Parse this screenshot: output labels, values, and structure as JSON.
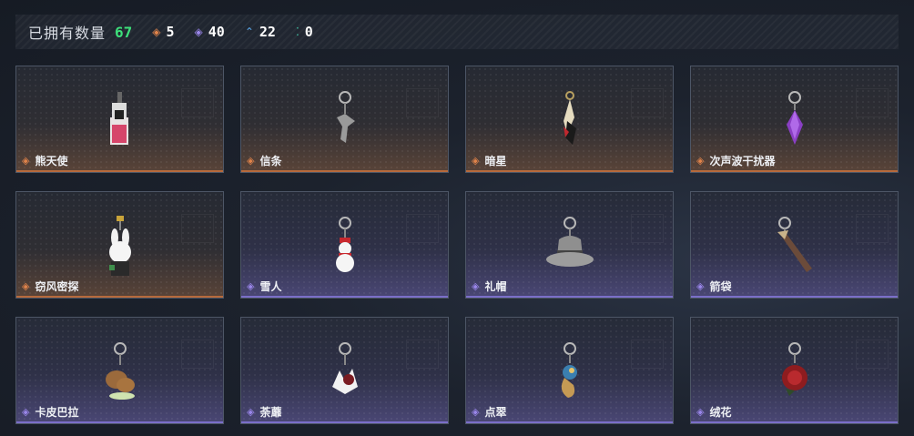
{
  "summary": {
    "owned_label": "已拥有数量",
    "owned_count": "67",
    "rarities": [
      {
        "icon": "legendary-diamond-icon",
        "color": "#e0834a",
        "count": "5"
      },
      {
        "icon": "epic-diamond-icon",
        "color": "#9a86ea",
        "count": "40"
      },
      {
        "icon": "rare-chevron-icon",
        "color": "#5aa6e8",
        "count": "22"
      },
      {
        "icon": "common-dots-icon",
        "color": "#3ec7a8",
        "count": "0"
      }
    ]
  },
  "items": [
    {
      "name": "熊天使",
      "rarity": "legendary"
    },
    {
      "name": "信条",
      "rarity": "legendary"
    },
    {
      "name": "暗星",
      "rarity": "legendary"
    },
    {
      "name": "次声波干扰器",
      "rarity": "legendary"
    },
    {
      "name": "窃风密探",
      "rarity": "legendary"
    },
    {
      "name": "雪人",
      "rarity": "epic"
    },
    {
      "name": "礼帽",
      "rarity": "epic"
    },
    {
      "name": "箭袋",
      "rarity": "epic"
    },
    {
      "name": "卡皮巴拉",
      "rarity": "epic"
    },
    {
      "name": "荼蘼",
      "rarity": "epic"
    },
    {
      "name": "点翠",
      "rarity": "epic"
    },
    {
      "name": "绒花",
      "rarity": "epic"
    }
  ]
}
